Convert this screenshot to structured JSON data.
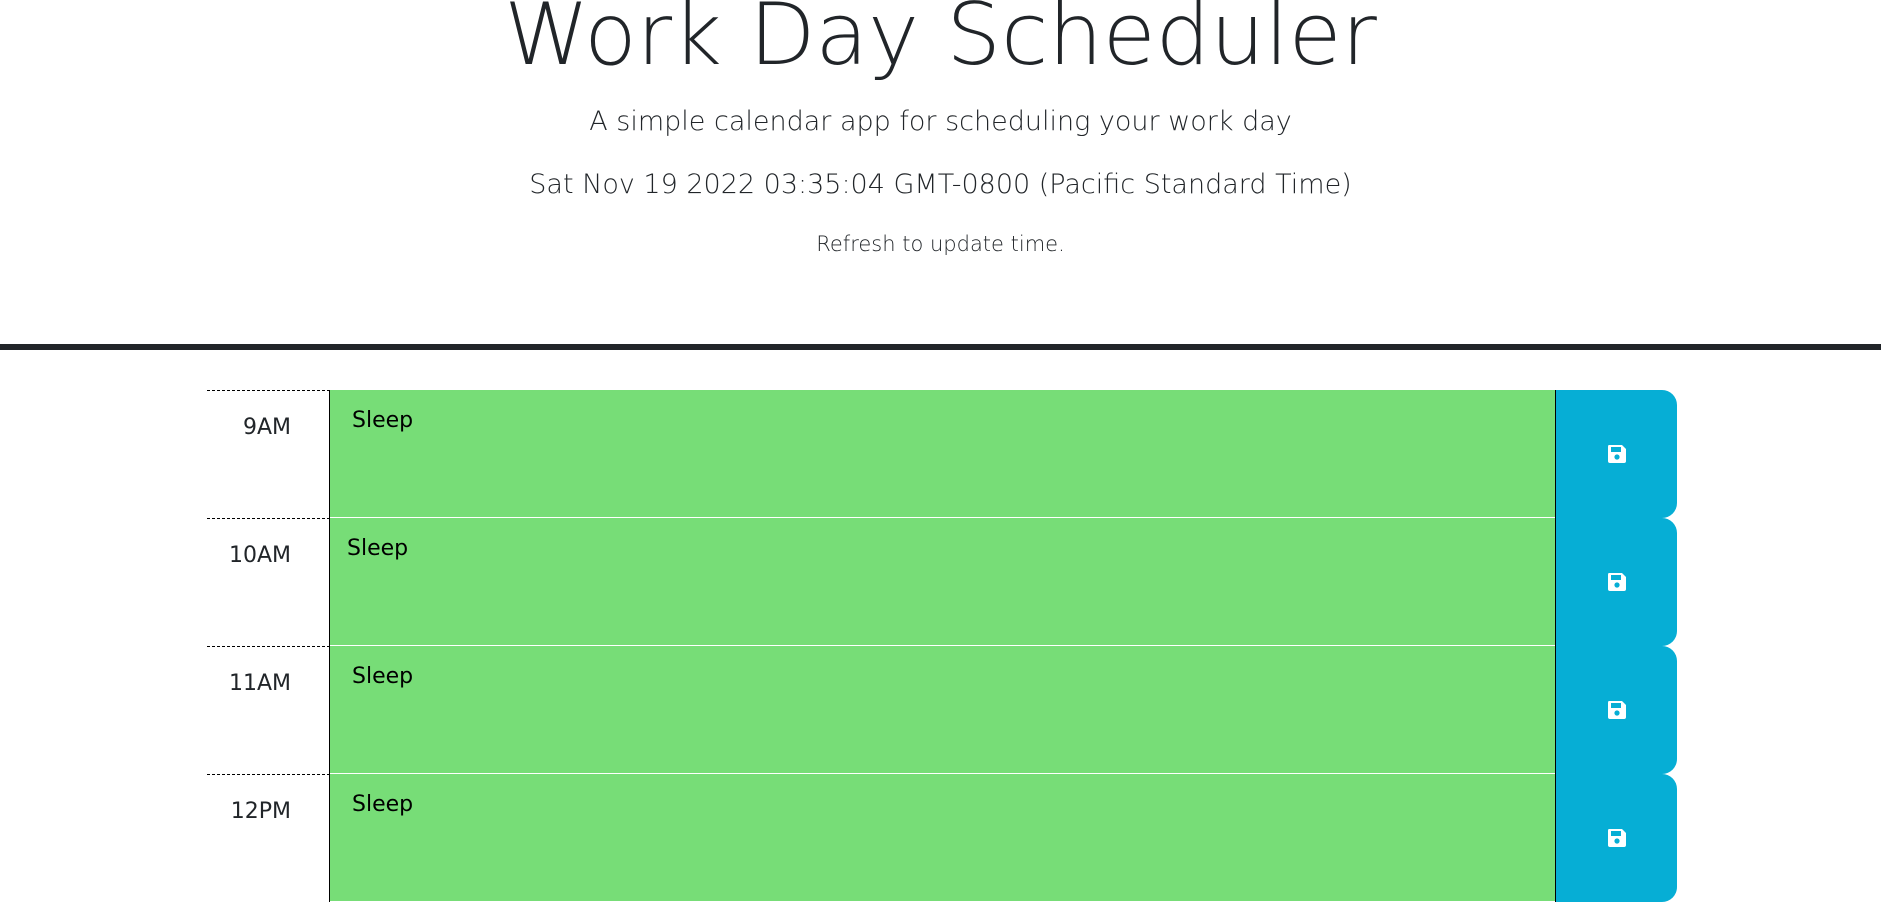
{
  "header": {
    "title": "Work Day Scheduler",
    "lead": "A simple calendar app for scheduling your work day",
    "current_day": "Sat Nov 19 2022 03:35:04 GMT-0800 (Pacific Standard Time)",
    "refresh_note": "Refresh to update time."
  },
  "time_blocks": [
    {
      "hour": "9AM",
      "text": "Sleep",
      "state": "future"
    },
    {
      "hour": "10AM",
      "text": "Sleep",
      "state": "future"
    },
    {
      "hour": "11AM",
      "text": "Sleep",
      "state": "future"
    },
    {
      "hour": "12PM",
      "text": "Sleep",
      "state": "future"
    }
  ],
  "colors": {
    "future": "#77dd77",
    "save_button": "#06aed5",
    "divider": "#212529"
  },
  "icons": {
    "save": "floppy-disk-icon"
  }
}
